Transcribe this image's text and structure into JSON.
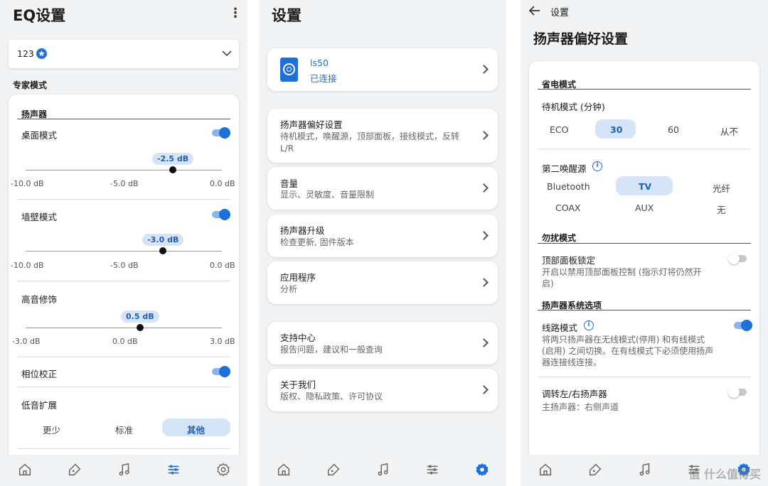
{
  "eq": {
    "title": "EQ设置",
    "menu_icon": "more-vert-icon",
    "preset_value": "123",
    "expert_mode": "专家模式",
    "speaker_header": "扬声器",
    "desk_mode": "桌面模式",
    "desk_value": "-2.5 dB",
    "desk_level": -2.5,
    "wall_mode": "墙壁模式",
    "wall_value": "-3.0 dB",
    "wall_level": -3.0,
    "treble": "高音修饰",
    "treble_value": "0.5 dB",
    "treble_level": 0.5,
    "range_ticks": [
      "-10.0 dB",
      "-5.0 dB",
      "0.0 dB"
    ],
    "treble_ticks": [
      "-3.0 dB",
      "0.0 dB",
      "3.0 dB"
    ],
    "phase": "相位校正",
    "bass_ext": "低音扩展",
    "bass_options": [
      "更少",
      "标准",
      "其他"
    ],
    "bass_selected": "其他",
    "toggles": {
      "desk": true,
      "wall": true,
      "phase": true
    }
  },
  "settings": {
    "title": "设置",
    "device_name": "ls50",
    "device_status": "已连接",
    "items": [
      {
        "title": "扬声器偏好设置",
        "sub": "待机模式，唤醒源，顶部面板，接线模式，反转L/R"
      },
      {
        "title": "音量",
        "sub": "显示、灵敏度、音量限制"
      },
      {
        "title": "扬声器升级",
        "sub": "检查更新, 固件版本"
      },
      {
        "title": "应用程序",
        "sub": "分析"
      },
      {
        "title": "支持中心",
        "sub": "报告问题，建议和一般查询"
      },
      {
        "title": "关于我们",
        "sub": "版权、隐私政策、许可协议"
      }
    ]
  },
  "prefs": {
    "back_title": "设置",
    "title": "扬声器偏好设置",
    "power_header": "省电模式",
    "standby_label": "待机模式 (分钟)",
    "standby_options": [
      "ECO",
      "30",
      "60",
      "从不"
    ],
    "standby_selected": "30",
    "wake_label": "第二唤醒源",
    "wake_options": [
      "Bluetooth",
      "TV",
      "光纤",
      "COAX",
      "AUX",
      "无"
    ],
    "wake_selected": "TV",
    "dnd_header": "勿扰模式",
    "top_lock": "顶部面板锁定",
    "top_lock_desc": "开启以禁用顶部面板控制 (指示灯将仍然开启)",
    "system_header": "扬声器系统选项",
    "wired_mode": "线路模式",
    "wired_desc": "将两只扬声器在无线模式(停用) 和有线模式(启用) 之间切换。在有线模式下必须使用扬声器连接线连接。",
    "swap_lr": "调转左/右扬声器",
    "primary": "主扬声器：右侧声道",
    "toggles": {
      "top_lock": false,
      "wired": true,
      "swap": false
    }
  },
  "watermark": "值 什么值得买",
  "colors": {
    "accent": "#1e6fd9",
    "pill": "#d6e4f7",
    "bg": "#f1f3f5"
  }
}
